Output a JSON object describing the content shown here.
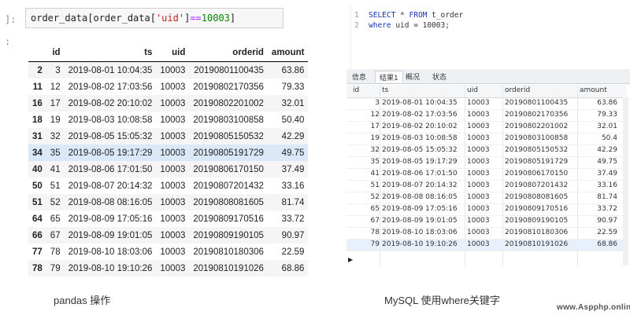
{
  "jupyter": {
    "prompt_in": "]:",
    "prompt_out": ":",
    "code": {
      "part1": "order_data[order_data[",
      "string": "'uid'",
      "part2": "]",
      "operator": "==",
      "number": "10003",
      "part3": "]"
    },
    "columns": [
      "",
      "id",
      "ts",
      "uid",
      "orderid",
      "amount"
    ],
    "rows": [
      {
        "index": "2",
        "id": "3",
        "ts": "2019-08-01 10:04:35",
        "uid": "10003",
        "orderid": "20190801100435",
        "amount": "63.86"
      },
      {
        "index": "11",
        "id": "12",
        "ts": "2019-08-02 17:03:56",
        "uid": "10003",
        "orderid": "20190802170356",
        "amount": "79.33"
      },
      {
        "index": "16",
        "id": "17",
        "ts": "2019-08-02 20:10:02",
        "uid": "10003",
        "orderid": "20190802201002",
        "amount": "32.01"
      },
      {
        "index": "18",
        "id": "19",
        "ts": "2019-08-03 10:08:58",
        "uid": "10003",
        "orderid": "20190803100858",
        "amount": "50.40"
      },
      {
        "index": "31",
        "id": "32",
        "ts": "2019-08-05 15:05:32",
        "uid": "10003",
        "orderid": "20190805150532",
        "amount": "42.29"
      },
      {
        "index": "34",
        "id": "35",
        "ts": "2019-08-05 19:17:29",
        "uid": "10003",
        "orderid": "20190805191729",
        "amount": "49.75"
      },
      {
        "index": "40",
        "id": "41",
        "ts": "2019-08-06 17:01:50",
        "uid": "10003",
        "orderid": "20190806170150",
        "amount": "37.49"
      },
      {
        "index": "50",
        "id": "51",
        "ts": "2019-08-07 20:14:32",
        "uid": "10003",
        "orderid": "20190807201432",
        "amount": "33.16"
      },
      {
        "index": "51",
        "id": "52",
        "ts": "2019-08-08 08:16:05",
        "uid": "10003",
        "orderid": "20190808081605",
        "amount": "81.74"
      },
      {
        "index": "64",
        "id": "65",
        "ts": "2019-08-09 17:05:16",
        "uid": "10003",
        "orderid": "20190809170516",
        "amount": "33.72"
      },
      {
        "index": "66",
        "id": "67",
        "ts": "2019-08-09 19:01:05",
        "uid": "10003",
        "orderid": "20190809190105",
        "amount": "90.97"
      },
      {
        "index": "77",
        "id": "78",
        "ts": "2019-08-10 18:03:06",
        "uid": "10003",
        "orderid": "20190810180306",
        "amount": "22.59"
      },
      {
        "index": "78",
        "id": "79",
        "ts": "2019-08-10 19:10:26",
        "uid": "10003",
        "orderid": "20190810191026",
        "amount": "68.86"
      }
    ],
    "caption": "pandas 操作"
  },
  "mysql": {
    "line_numbers": [
      "1",
      "2"
    ],
    "sql_line1": {
      "kw1": "SELECT",
      "mid": " * ",
      "kw2": "FROM",
      "rest": " t_order"
    },
    "sql_line2": {
      "kw1": "where",
      "rest": " uid = 10003;"
    },
    "tabs": [
      "信息",
      "结果1",
      "概况",
      "状态"
    ],
    "active_tab": "结果1",
    "columns": [
      "id",
      "ts",
      "uid",
      "orderid",
      "amount"
    ],
    "row_marker": "▶",
    "rows": [
      {
        "id": "3",
        "ts": "2019-08-01 10:04:35",
        "uid": "10003",
        "orderid": "20190801100435",
        "amount": "63.86"
      },
      {
        "id": "12",
        "ts": "2019-08-02 17:03:56",
        "uid": "10003",
        "orderid": "20190802170356",
        "amount": "79.33"
      },
      {
        "id": "17",
        "ts": "2019-08-02 20:10:02",
        "uid": "10003",
        "orderid": "20190802201002",
        "amount": "32.01"
      },
      {
        "id": "19",
        "ts": "2019-08-03 10:08:58",
        "uid": "10003",
        "orderid": "20190803100858",
        "amount": "50.4"
      },
      {
        "id": "32",
        "ts": "2019-08-05 15:05:32",
        "uid": "10003",
        "orderid": "20190805150532",
        "amount": "42.29"
      },
      {
        "id": "35",
        "ts": "2019-08-05 19:17:29",
        "uid": "10003",
        "orderid": "20190805191729",
        "amount": "49.75"
      },
      {
        "id": "41",
        "ts": "2019-08-06 17:01:50",
        "uid": "10003",
        "orderid": "20190806170150",
        "amount": "37.49"
      },
      {
        "id": "51",
        "ts": "2019-08-07 20:14:32",
        "uid": "10003",
        "orderid": "20190807201432",
        "amount": "33.16"
      },
      {
        "id": "52",
        "ts": "2019-08-08 08:16:05",
        "uid": "10003",
        "orderid": "20190808081605",
        "amount": "81.74"
      },
      {
        "id": "65",
        "ts": "2019-08-09 17:05:16",
        "uid": "10003",
        "orderid": "20190809170516",
        "amount": "33.72"
      },
      {
        "id": "67",
        "ts": "2019-08-09 19:01:05",
        "uid": "10003",
        "orderid": "20190809190105",
        "amount": "90.97"
      },
      {
        "id": "78",
        "ts": "2019-08-10 18:03:06",
        "uid": "10003",
        "orderid": "20190810180306",
        "amount": "22.59"
      },
      {
        "id": "79",
        "ts": "2019-08-10 19:10:26",
        "uid": "10003",
        "orderid": "20190810191026",
        "amount": "68.86"
      }
    ],
    "caption": "MySQL 使用where关键字"
  },
  "watermark": "www.Aspphp.online",
  "colors": {
    "highlight_row": "#dbe8f7",
    "sql_keyword": "#1a35b5",
    "py_string": "#ba2121",
    "py_number": "#008800"
  }
}
